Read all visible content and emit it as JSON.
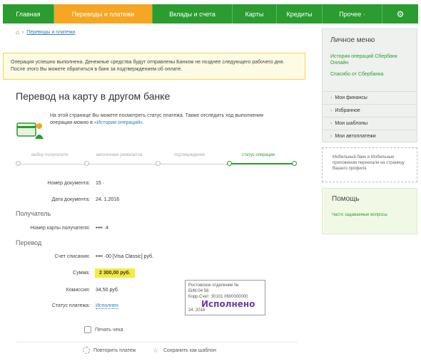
{
  "nav": {
    "items": [
      "Главная",
      "Переводы и платежи",
      "Вклады и счета",
      "Карты",
      "Кредиты",
      "Прочее ·"
    ],
    "gear_icon": "gear-icon"
  },
  "breadcrumb": {
    "home_icon": "home-icon",
    "link": "Переводы и платежи"
  },
  "notice": "Операция успешно выполнена. Денежные средства будут отправлены Банком не позднее следующего рабочего дня. После этого Вы можете обратиться в банк за подтверждением об оплате.",
  "title": "Перевод на карту в другом банке",
  "info": {
    "text_before": "На этой странице Вы можете посмотреть статус платежа. Также отследить ход выполнения операции можно в ",
    "link": "«Истории операций»",
    "text_after": "."
  },
  "steps": [
    "выбор получателя",
    "заполнение реквизитов",
    "подтверждение",
    "статус операции"
  ],
  "details": {
    "doc_number_label": "Номер документа:",
    "doc_number_value": "15 ·",
    "doc_date_label": "Дата документа:",
    "doc_date_value": "24. 1.2016",
    "recipient_section": "Получатель",
    "card_label": "Номер карты получателя:",
    "card_value": "•••• ·4",
    "transfer_section": "Перевод",
    "account_label": "Счет списания:",
    "account_value": "•••• ·00 [Visa Classic] руб.",
    "sum_label": "Сумма:",
    "sum_value": "2 300,00 руб.",
    "fee_label": "Комиссия:",
    "fee_value": "34,50 руб.",
    "status_label": "Статус платежа:",
    "status_value": "Исполнен"
  },
  "stamp": {
    "line1": "Ростовское отделение №",
    "line2": "БИК:04     56",
    "line3": "Корр.Счет: 30101   0600000000",
    "main": "Исполнено",
    "date": "24.    2016"
  },
  "actions": {
    "print": "Печать чека",
    "repeat": "Повторить платеж",
    "template": "Сохранить как шаблон"
  },
  "sidebar": {
    "title": "Личное меню",
    "link1": "История операций Сбербанк Онлайн",
    "link2": "Спасибо от Сбербанка",
    "items": [
      "Мои финансы",
      "Избранное",
      "Мои шаблоны",
      "Мои автоплатежи"
    ],
    "note": "Мобильный банк и Мобильные приложения переехали на страницу Вашего профиля",
    "help_title": "Помощь",
    "help_link": "Часто задаваемые вопросы"
  },
  "colors": {
    "brand_green": "#2a9c30",
    "active_orange": "#f5a623",
    "amount_yellow": "#f6e940",
    "stamp_purple": "#6b3fa0"
  }
}
